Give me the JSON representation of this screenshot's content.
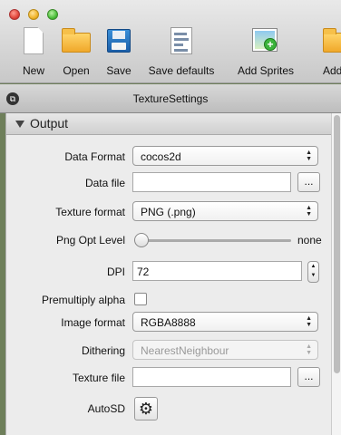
{
  "toolbar": {
    "items": [
      {
        "label": "New",
        "icon": "new-document-icon"
      },
      {
        "label": "Open",
        "icon": "folder-icon"
      },
      {
        "label": "Save",
        "icon": "floppy-disk-icon"
      },
      {
        "label": "Save defaults",
        "icon": "save-defaults-icon"
      },
      {
        "label": "Add Sprites",
        "icon": "add-sprites-icon"
      },
      {
        "label": "Add F",
        "icon": "add-folder-icon"
      }
    ]
  },
  "window": {
    "title": "TextureSettings"
  },
  "section": {
    "title": "Output"
  },
  "fields": {
    "data_format": {
      "label": "Data Format",
      "value": "cocos2d"
    },
    "data_file": {
      "label": "Data file",
      "value": "",
      "browse": "..."
    },
    "texture_format": {
      "label": "Texture format",
      "value": "PNG (.png)"
    },
    "png_opt_level": {
      "label": "Png Opt Level",
      "value": "none"
    },
    "dpi": {
      "label": "DPI",
      "value": "72"
    },
    "premultiply_alpha": {
      "label": "Premultiply alpha",
      "checked": false
    },
    "image_format": {
      "label": "Image format",
      "value": "RGBA8888"
    },
    "dithering": {
      "label": "Dithering",
      "value": "NearestNeighbour"
    },
    "texture_file": {
      "label": "Texture file",
      "value": "",
      "browse": "..."
    },
    "autosd": {
      "label": "AutoSD"
    }
  },
  "icons": {
    "select_arrows": "▲▼",
    "gear": "⚙",
    "stepper": "▲▼"
  }
}
